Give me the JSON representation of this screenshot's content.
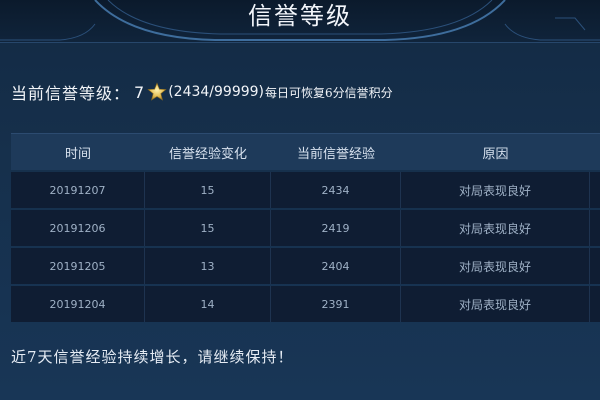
{
  "header": {
    "title": "信誉等级"
  },
  "level": {
    "label": "当前信誉等级：",
    "value": "7",
    "star_icon": "star-icon",
    "star_color": "#e7c25a",
    "experience": "(2434/99999)",
    "recovery_note": "每日可恢复6分信誉积分"
  },
  "table": {
    "headers": [
      "时间",
      "信誉经验变化",
      "当前信誉经验",
      "原因"
    ],
    "rows": [
      {
        "date": "20191207",
        "change": "15",
        "current": "2434",
        "reason": "对局表现良好"
      },
      {
        "date": "20191206",
        "change": "15",
        "current": "2419",
        "reason": "对局表现良好"
      },
      {
        "date": "20191205",
        "change": "13",
        "current": "2404",
        "reason": "对局表现良好"
      },
      {
        "date": "20191204",
        "change": "14",
        "current": "2391",
        "reason": "对局表现良好"
      }
    ]
  },
  "footer": {
    "message": "近7天信誉经验持续增长，请继续保持！"
  }
}
